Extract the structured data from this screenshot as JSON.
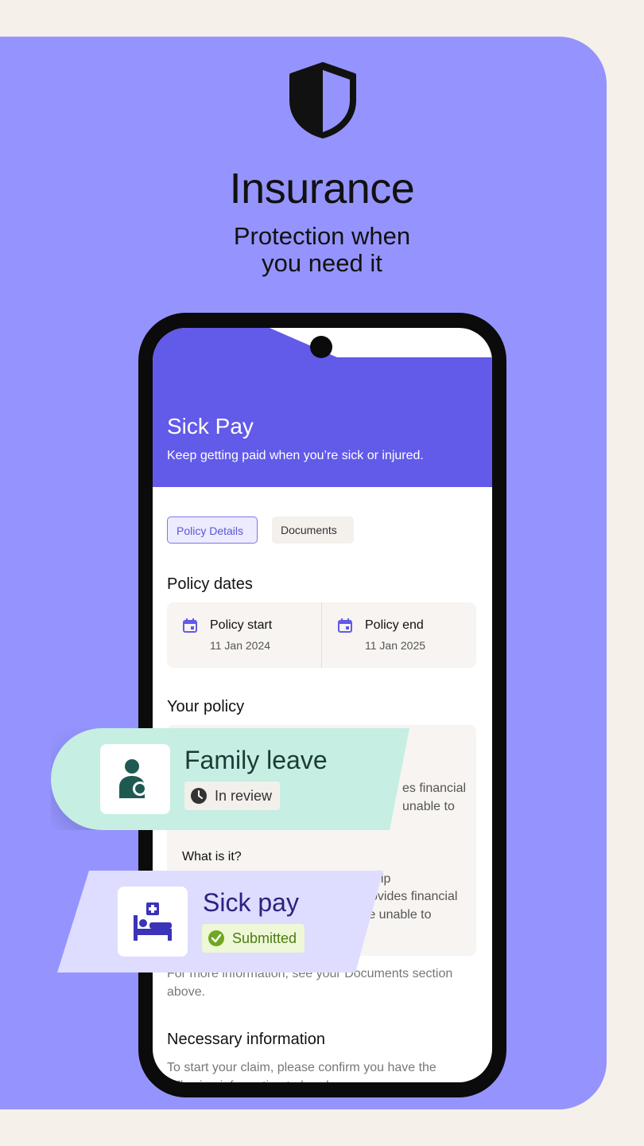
{
  "hero": {
    "title": "Insurance",
    "subtitle_line1": "Protection when",
    "subtitle_line2": "you need it"
  },
  "app": {
    "header": {
      "title": "Sick Pay",
      "subtitle": "Keep getting paid when you’re sick or injured."
    },
    "tabs": [
      {
        "label": "Policy Details",
        "active": true
      },
      {
        "label": "Documents",
        "active": false
      }
    ],
    "policy_dates": {
      "title": "Policy dates",
      "start": {
        "label": "Policy start",
        "value": "11 Jan 2024"
      },
      "end": {
        "label": "Policy end",
        "value": "11 Jan 2025"
      }
    },
    "your_policy": {
      "title": "Your policy",
      "partial_line1": "es financial",
      "partial_line2": "unable to",
      "what_is_it": "What is it?",
      "partial_line3": "hip",
      "partial_line4": "ovides financial",
      "partial_line5": "re unable to"
    },
    "more_info": "For more information, see your Documents section above.",
    "necessary": {
      "title": "Necessary information",
      "text": "To start your claim, please confirm you have the following information to hand."
    }
  },
  "floating_cards": {
    "family_leave": {
      "title": "Family leave",
      "status": "In review"
    },
    "sick_pay": {
      "title": "Sick pay",
      "status": "Submitted"
    }
  },
  "colors": {
    "background": "#f5f0ea",
    "panel": "#9594fe",
    "header": "#625ae8",
    "family_card": "#c6eee3",
    "sick_card": "#dedcff",
    "submitted_green": "#6fa81f",
    "family_icon": "#1f5a52",
    "sick_icon": "#3b33b8"
  }
}
